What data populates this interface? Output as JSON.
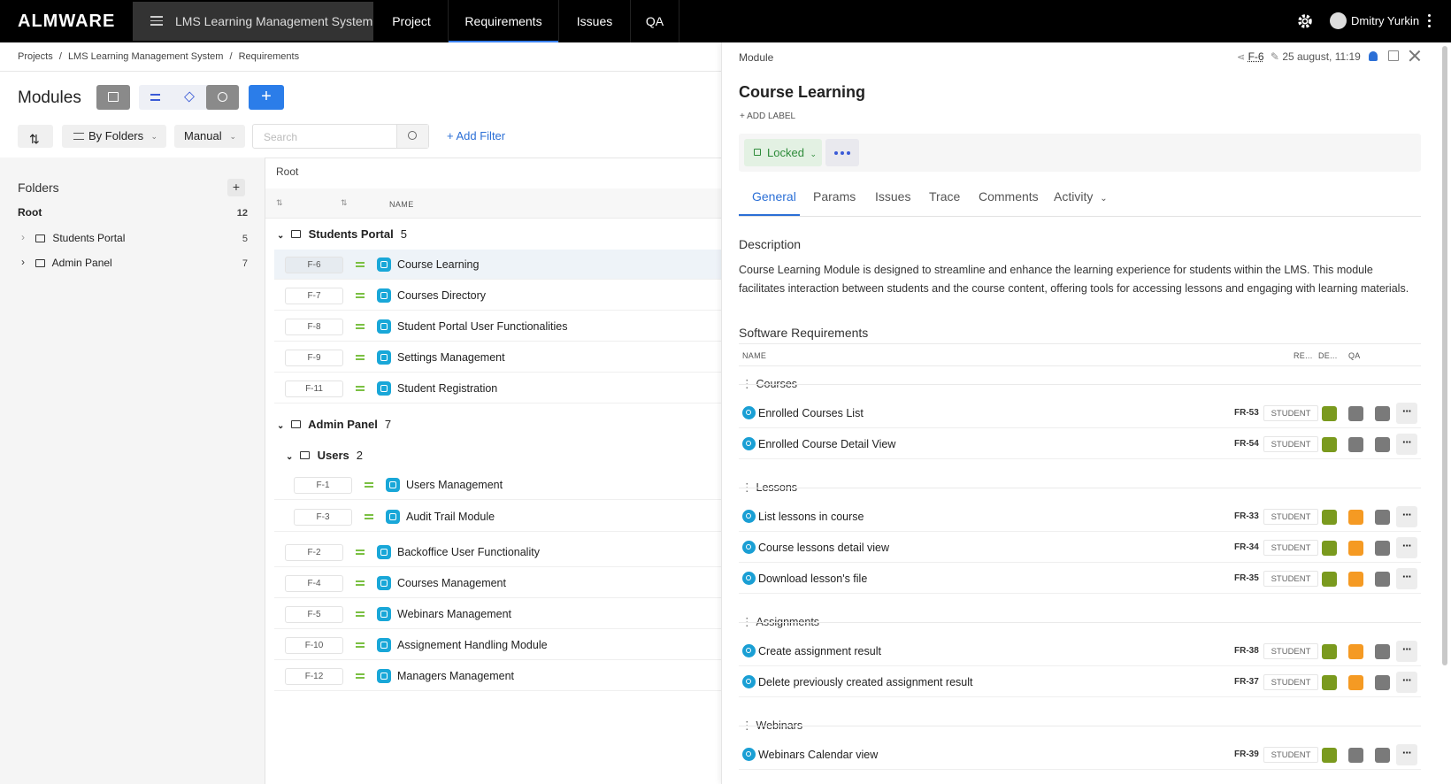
{
  "app": {
    "logo": "ALMWARE",
    "project": "LMS Learning Management System",
    "tabs": [
      "Project",
      "Requirements",
      "Issues",
      "QA"
    ],
    "active_tab": "Requirements",
    "user": "Dmitry Yurkin"
  },
  "breadcrumb": [
    "Projects",
    "/",
    "LMS Learning Management System",
    "/",
    "Requirements"
  ],
  "toolbar": {
    "title": "Modules",
    "group_by": "By Folders",
    "sort_mode": "Manual",
    "search_placeholder": "Search",
    "add_filter": "+ Add Filter"
  },
  "folders": {
    "heading": "Folders",
    "items": [
      {
        "label": "Root",
        "count": "12"
      },
      {
        "label": "Students Portal",
        "count": "5"
      },
      {
        "label": "Admin Panel",
        "count": "7"
      }
    ]
  },
  "grid": {
    "root_label": "Root",
    "name_col": "NAME",
    "groups": [
      {
        "label": "Students Portal",
        "count": "5"
      },
      {
        "label": "Admin Panel",
        "count": "7"
      },
      {
        "label": "Users",
        "count": "2"
      }
    ],
    "rows": [
      {
        "id": "F-6",
        "name": "Course Learning"
      },
      {
        "id": "F-7",
        "name": "Courses Directory"
      },
      {
        "id": "F-8",
        "name": "Student Portal User Functionalities"
      },
      {
        "id": "F-9",
        "name": "Settings Management"
      },
      {
        "id": "F-11",
        "name": "Student Registration"
      },
      {
        "id": "F-1",
        "name": "Users Management"
      },
      {
        "id": "F-3",
        "name": "Audit Trail Module"
      },
      {
        "id": "F-2",
        "name": "Backoffice User Functionality"
      },
      {
        "id": "F-4",
        "name": "Courses Management"
      },
      {
        "id": "F-5",
        "name": "Webinars Management"
      },
      {
        "id": "F-10",
        "name": "Assignement Handling Module"
      },
      {
        "id": "F-12",
        "name": "Managers Management"
      }
    ]
  },
  "detail": {
    "type": "Module",
    "id": "F-6",
    "updated": "25 august, 11:19",
    "title": "Course Learning",
    "add_label": "+ ADD LABEL",
    "status": "Locked",
    "tabs": [
      "General",
      "Params",
      "Issues",
      "Trace",
      "Comments",
      "Activity"
    ],
    "active_tab": "General",
    "description_heading": "Description",
    "description": "Course Learning Module is designed to streamline and enhance the learning experience for students within the LMS. This module facilitates interaction between students and the course content, offering tools for accessing lessons and engaging with learning materials.",
    "sr_heading": "Software Requirements",
    "sr_cols": [
      "NAME",
      "RE...",
      "DE...",
      "QA"
    ],
    "sr_groups": [
      "Courses",
      "Lessons",
      "Assignments",
      "Webinars"
    ],
    "sr_rows": [
      {
        "name": "Enrolled Courses List",
        "id": "FR-53",
        "tag": "STUDENT",
        "st": [
          "#7a9a1e",
          "#7a7a7a",
          "#7a7a7a"
        ]
      },
      {
        "name": "Enrolled Course Detail View",
        "id": "FR-54",
        "tag": "STUDENT",
        "st": [
          "#7a9a1e",
          "#7a7a7a",
          "#7a7a7a"
        ]
      },
      {
        "name": "List lessons in course",
        "id": "FR-33",
        "tag": "STUDENT",
        "st": [
          "#7a9a1e",
          "#f59a23",
          "#7a7a7a"
        ]
      },
      {
        "name": "Course lessons detail view",
        "id": "FR-34",
        "tag": "STUDENT",
        "st": [
          "#7a9a1e",
          "#f59a23",
          "#7a7a7a"
        ]
      },
      {
        "name": "Download lesson's file",
        "id": "FR-35",
        "tag": "STUDENT",
        "st": [
          "#7a9a1e",
          "#f59a23",
          "#7a7a7a"
        ]
      },
      {
        "name": "Create assignment result",
        "id": "FR-38",
        "tag": "STUDENT",
        "st": [
          "#7a9a1e",
          "#f59a23",
          "#7a7a7a"
        ]
      },
      {
        "name": "Delete previously created assignment result",
        "id": "FR-37",
        "tag": "STUDENT",
        "st": [
          "#7a9a1e",
          "#f59a23",
          "#7a7a7a"
        ]
      },
      {
        "name": "Webinars Calendar view",
        "id": "FR-39",
        "tag": "STUDENT",
        "st": [
          "#7a9a1e",
          "#7a7a7a",
          "#7a7a7a"
        ]
      }
    ]
  },
  "colors": {
    "accent": "#2b6fd6",
    "green": "#7a9a1e",
    "orange": "#f59a23",
    "gray": "#7a7a7a",
    "module_icon": "#19a7d8"
  }
}
